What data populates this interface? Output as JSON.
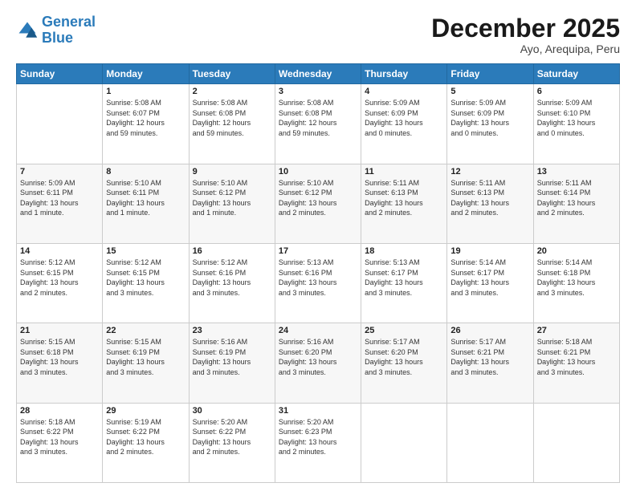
{
  "logo": {
    "line1": "General",
    "line2": "Blue"
  },
  "header": {
    "month": "December 2025",
    "location": "Ayo, Arequipa, Peru"
  },
  "weekdays": [
    "Sunday",
    "Monday",
    "Tuesday",
    "Wednesday",
    "Thursday",
    "Friday",
    "Saturday"
  ],
  "weeks": [
    [
      {
        "day": "",
        "content": ""
      },
      {
        "day": "1",
        "content": "Sunrise: 5:08 AM\nSunset: 6:07 PM\nDaylight: 12 hours\nand 59 minutes."
      },
      {
        "day": "2",
        "content": "Sunrise: 5:08 AM\nSunset: 6:08 PM\nDaylight: 12 hours\nand 59 minutes."
      },
      {
        "day": "3",
        "content": "Sunrise: 5:08 AM\nSunset: 6:08 PM\nDaylight: 12 hours\nand 59 minutes."
      },
      {
        "day": "4",
        "content": "Sunrise: 5:09 AM\nSunset: 6:09 PM\nDaylight: 13 hours\nand 0 minutes."
      },
      {
        "day": "5",
        "content": "Sunrise: 5:09 AM\nSunset: 6:09 PM\nDaylight: 13 hours\nand 0 minutes."
      },
      {
        "day": "6",
        "content": "Sunrise: 5:09 AM\nSunset: 6:10 PM\nDaylight: 13 hours\nand 0 minutes."
      }
    ],
    [
      {
        "day": "7",
        "content": "Sunrise: 5:09 AM\nSunset: 6:11 PM\nDaylight: 13 hours\nand 1 minute."
      },
      {
        "day": "8",
        "content": "Sunrise: 5:10 AM\nSunset: 6:11 PM\nDaylight: 13 hours\nand 1 minute."
      },
      {
        "day": "9",
        "content": "Sunrise: 5:10 AM\nSunset: 6:12 PM\nDaylight: 13 hours\nand 1 minute."
      },
      {
        "day": "10",
        "content": "Sunrise: 5:10 AM\nSunset: 6:12 PM\nDaylight: 13 hours\nand 2 minutes."
      },
      {
        "day": "11",
        "content": "Sunrise: 5:11 AM\nSunset: 6:13 PM\nDaylight: 13 hours\nand 2 minutes."
      },
      {
        "day": "12",
        "content": "Sunrise: 5:11 AM\nSunset: 6:13 PM\nDaylight: 13 hours\nand 2 minutes."
      },
      {
        "day": "13",
        "content": "Sunrise: 5:11 AM\nSunset: 6:14 PM\nDaylight: 13 hours\nand 2 minutes."
      }
    ],
    [
      {
        "day": "14",
        "content": "Sunrise: 5:12 AM\nSunset: 6:15 PM\nDaylight: 13 hours\nand 2 minutes."
      },
      {
        "day": "15",
        "content": "Sunrise: 5:12 AM\nSunset: 6:15 PM\nDaylight: 13 hours\nand 3 minutes."
      },
      {
        "day": "16",
        "content": "Sunrise: 5:12 AM\nSunset: 6:16 PM\nDaylight: 13 hours\nand 3 minutes."
      },
      {
        "day": "17",
        "content": "Sunrise: 5:13 AM\nSunset: 6:16 PM\nDaylight: 13 hours\nand 3 minutes."
      },
      {
        "day": "18",
        "content": "Sunrise: 5:13 AM\nSunset: 6:17 PM\nDaylight: 13 hours\nand 3 minutes."
      },
      {
        "day": "19",
        "content": "Sunrise: 5:14 AM\nSunset: 6:17 PM\nDaylight: 13 hours\nand 3 minutes."
      },
      {
        "day": "20",
        "content": "Sunrise: 5:14 AM\nSunset: 6:18 PM\nDaylight: 13 hours\nand 3 minutes."
      }
    ],
    [
      {
        "day": "21",
        "content": "Sunrise: 5:15 AM\nSunset: 6:18 PM\nDaylight: 13 hours\nand 3 minutes."
      },
      {
        "day": "22",
        "content": "Sunrise: 5:15 AM\nSunset: 6:19 PM\nDaylight: 13 hours\nand 3 minutes."
      },
      {
        "day": "23",
        "content": "Sunrise: 5:16 AM\nSunset: 6:19 PM\nDaylight: 13 hours\nand 3 minutes."
      },
      {
        "day": "24",
        "content": "Sunrise: 5:16 AM\nSunset: 6:20 PM\nDaylight: 13 hours\nand 3 minutes."
      },
      {
        "day": "25",
        "content": "Sunrise: 5:17 AM\nSunset: 6:20 PM\nDaylight: 13 hours\nand 3 minutes."
      },
      {
        "day": "26",
        "content": "Sunrise: 5:17 AM\nSunset: 6:21 PM\nDaylight: 13 hours\nand 3 minutes."
      },
      {
        "day": "27",
        "content": "Sunrise: 5:18 AM\nSunset: 6:21 PM\nDaylight: 13 hours\nand 3 minutes."
      }
    ],
    [
      {
        "day": "28",
        "content": "Sunrise: 5:18 AM\nSunset: 6:22 PM\nDaylight: 13 hours\nand 3 minutes."
      },
      {
        "day": "29",
        "content": "Sunrise: 5:19 AM\nSunset: 6:22 PM\nDaylight: 13 hours\nand 2 minutes."
      },
      {
        "day": "30",
        "content": "Sunrise: 5:20 AM\nSunset: 6:22 PM\nDaylight: 13 hours\nand 2 minutes."
      },
      {
        "day": "31",
        "content": "Sunrise: 5:20 AM\nSunset: 6:23 PM\nDaylight: 13 hours\nand 2 minutes."
      },
      {
        "day": "",
        "content": ""
      },
      {
        "day": "",
        "content": ""
      },
      {
        "day": "",
        "content": ""
      }
    ]
  ]
}
